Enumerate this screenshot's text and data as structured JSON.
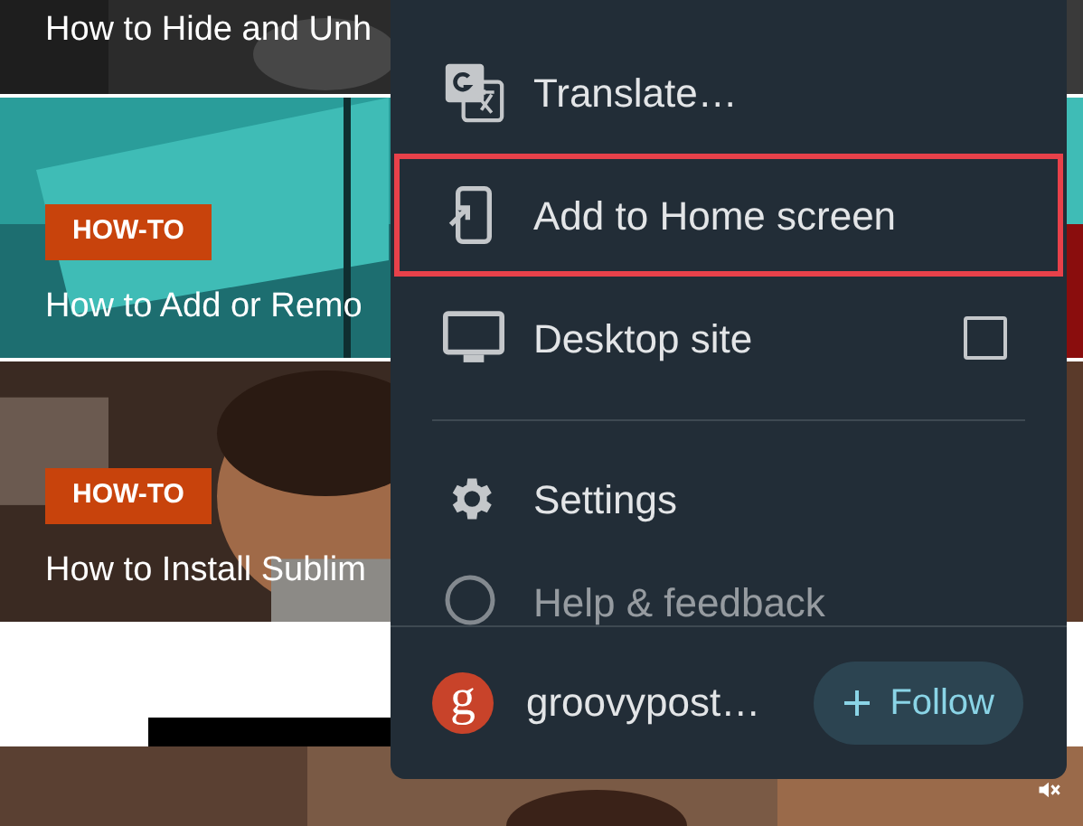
{
  "articles": [
    {
      "title": "How to Hide and Unh"
    },
    {
      "title": "How to Add or Remo",
      "tag": "HOW-TO"
    },
    {
      "title": "How to Install Sublim",
      "tag": "HOW-TO"
    }
  ],
  "menu": {
    "items": [
      {
        "kind": "action",
        "label": "Translate…",
        "highlighted": false
      },
      {
        "kind": "action",
        "label": "Add to Home screen",
        "highlighted": true
      },
      {
        "kind": "checkbox",
        "label": "Desktop site",
        "checked": false,
        "highlighted": false
      },
      {
        "kind": "divider"
      },
      {
        "kind": "action",
        "label": "Settings",
        "highlighted": false
      },
      {
        "kind": "faded",
        "label": "Help & feedback",
        "highlighted": false
      }
    ],
    "footer": {
      "avatar_letter": "g",
      "site": "groovypost…",
      "button": "Follow"
    }
  }
}
